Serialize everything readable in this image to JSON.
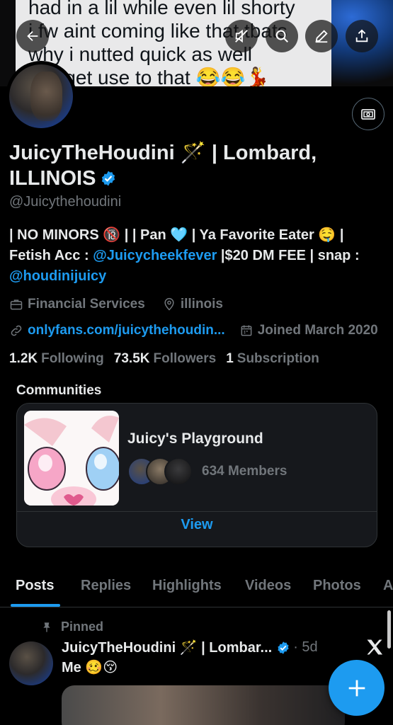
{
  "banner": {
    "caption_lines": [
      "had in a lil while even lil shorty",
      "i fw aint coming like that tbats",
      "why i nutted quick as well",
      "…a get use to that 😂😂💃"
    ]
  },
  "toolbar": {
    "back_icon": "arrow-left-icon",
    "mute_icon": "mute-icon",
    "search_icon": "search-icon",
    "edit_icon": "edit-icon",
    "share_icon": "share-icon"
  },
  "profile": {
    "display_name": "JuicyTheHoudini 🪄 | Lombard, ILLINOIS",
    "handle": "@Juicythehoudini",
    "bio_line1": "| NO MINORS 🔞 | | Pan 🩵 | Ya Favorite Eater 🤤 |",
    "bio_line2_prefix": "Fetish Acc : ",
    "bio_link1": "@Juicycheekfever",
    "bio_line2_suffix": " |$20 DM FEE | snap :",
    "bio_link2": "@houdinijuicy",
    "category": "Financial Services",
    "location": "illinois",
    "website": "onlyfans.com/juicythehoudin...",
    "joined": "Joined March 2020",
    "following_count": "1.2K",
    "following_label": "Following",
    "followers_count": "73.5K",
    "followers_label": "Followers",
    "subscriptions_count": "1",
    "subscriptions_label": "Subscription"
  },
  "communities": {
    "title": "Communities",
    "name": "Juicy's Playground",
    "members": "634 Members",
    "view_label": "View"
  },
  "tabs": [
    "Posts",
    "Replies",
    "Highlights",
    "Videos",
    "Photos",
    "A"
  ],
  "post": {
    "pinned_label": "Pinned",
    "author": "JuicyTheHoudini 🪄 | Lombar...",
    "time": "· 5d",
    "text": "Me 🥴😚"
  },
  "colors": {
    "accent": "#1d9bf0",
    "background": "#000000",
    "secondary_text": "#71767b"
  }
}
